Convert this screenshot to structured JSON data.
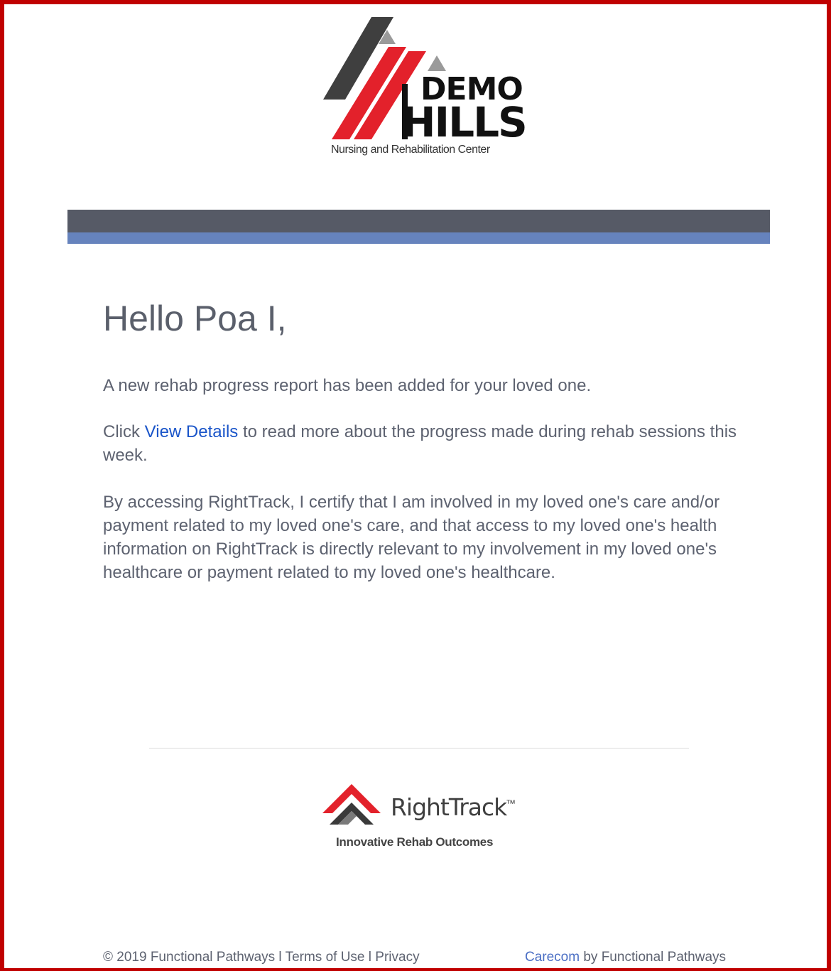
{
  "brand": {
    "logo_word1": "DEMO",
    "logo_word2": "HILLS",
    "logo_subtitle": "Nursing and Rehabilitation Center",
    "logo_colors": {
      "red": "#e3212b",
      "dark": "#3f3f3f",
      "gray": "#9a9a9a"
    }
  },
  "banner": {
    "dark_color": "#565a66",
    "accent_color": "#6683bd"
  },
  "message": {
    "greeting": "Hello Poa I,",
    "para1": "A new rehab progress report has been added for your loved one.",
    "para2_prefix": "Click ",
    "para2_link": "View Details",
    "para2_suffix": " to read more about the progress made during rehab sessions this week.",
    "para3": "By accessing RightTrack, I certify that I am involved in my loved one's care and/or payment related to my loved one's care, and that access to my loved one's health information on RightTrack is directly relevant to my involvement in my loved one's healthcare or payment related to my loved one's healthcare."
  },
  "righttrack": {
    "name": "RightTrack",
    "trademark": "™",
    "tagline": "Innovative Rehab Outcomes"
  },
  "footer": {
    "copyright": "© 2019 Functional Pathways",
    "sep1": " l ",
    "terms": "Terms of Use",
    "sep2": " l ",
    "privacy": "Privacy",
    "carecom": "Carecom",
    "by": " by Functional Pathways"
  }
}
